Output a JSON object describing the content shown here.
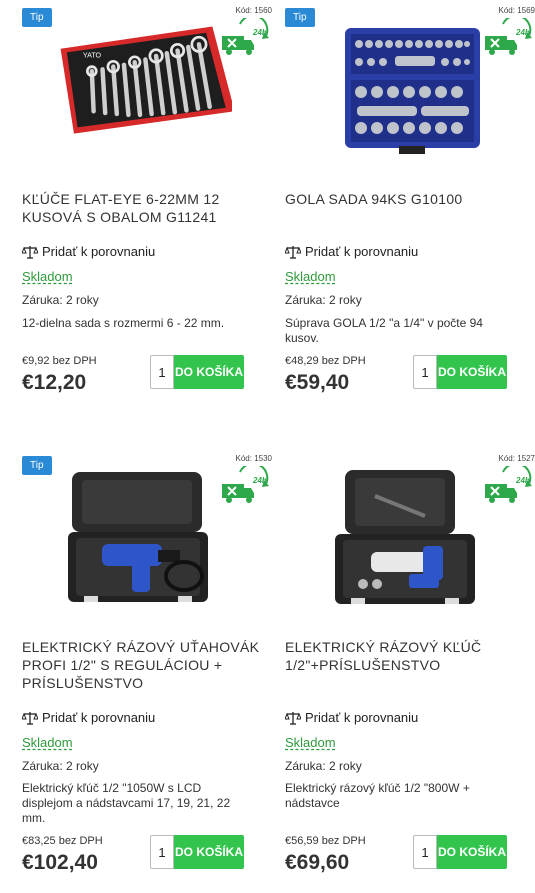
{
  "products": [
    {
      "tip": "Tip",
      "code": "Kód: 1560",
      "title": "KĽÚČE FLAT-EYE 6-22MM 12 KUSOVÁ S OBALOM G11241",
      "compare": "Pridať k porovnaniu",
      "stock": "Skladom",
      "warranty": "Záruka: 2 roky",
      "description": "12-dielna sada s rozmermi 6 - 22 mm.",
      "price_ex_vat": "€9,92 bez DPH",
      "price": "€12,20",
      "qty": "1",
      "cart": "DO KOŠÍKA",
      "image": "wrench-set-image",
      "logo_text": "YATO"
    },
    {
      "tip": "Tip",
      "code": "Kód: 1569",
      "title": "GOLA SADA 94KS G10100",
      "compare": "Pridať k porovnaniu",
      "stock": "Skladom",
      "warranty": "Záruka: 2 roky",
      "description": "Súprava GOLA 1/2 \"a 1/4\" v počte 94 kusov.",
      "price_ex_vat": "€48,29 bez DPH",
      "price": "€59,40",
      "qty": "1",
      "cart": "DO KOŠÍKA",
      "image": "socket-set-image"
    },
    {
      "tip": "Tip",
      "code": "Kód: 1530",
      "title": "ELEKTRICKÝ RÁZOVÝ UŤAHOVÁK PROFI 1/2\" S REGULÁCIOU + PRÍSLUŠENSTVO",
      "compare": "Pridať k porovnaniu",
      "stock": "Skladom",
      "warranty": "Záruka: 2 roky",
      "description": "Elektrický kľúč 1/2 \"1050W s LCD displejom a nádstavcami 17, 19, 21, 22 mm.",
      "price_ex_vat": "€83,25 bez DPH",
      "price": "€102,40",
      "qty": "1",
      "cart": "DO KOŠÍKA",
      "image": "impact-wrench-case-image"
    },
    {
      "tip": "",
      "code": "Kód: 1527",
      "title": "ELEKTRICKÝ RÁZOVÝ KĽÚČ 1/2\"+PRÍSLUŠENSTVO",
      "compare": "Pridať k porovnaniu",
      "stock": "Skladom",
      "warranty": "Záruka: 2 roky",
      "description": "Elektrický rázový kľúč 1/2 \"800W + nádstavce",
      "price_ex_vat": "€56,59 bez DPH",
      "price": "€69,60",
      "qty": "1",
      "cart": "DO KOŠÍKA",
      "image": "impact-wrench-case-image"
    }
  ],
  "delivery_badge": {
    "text": "24h",
    "icon": "delivery-truck-24h-icon"
  },
  "colors": {
    "tip": "#2b8ad6",
    "stock": "#2e9a3b",
    "cart": "#33c44d"
  }
}
